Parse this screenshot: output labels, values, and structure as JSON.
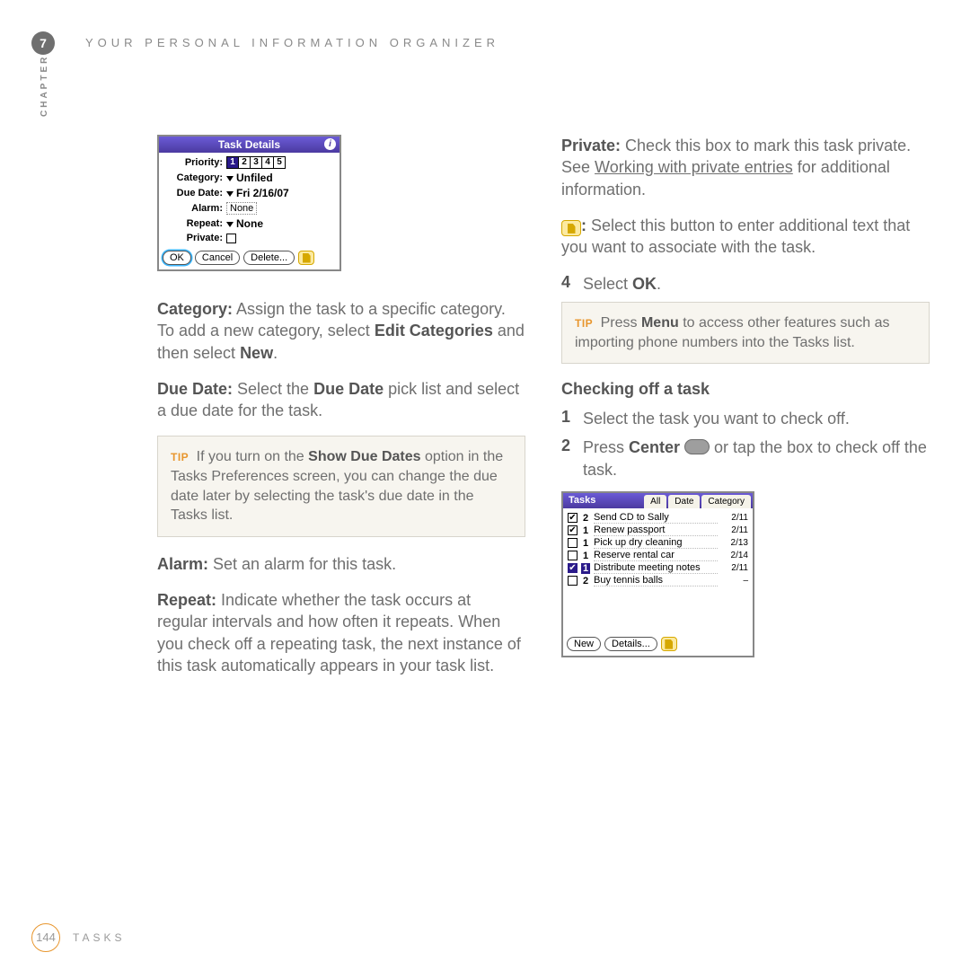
{
  "header": {
    "chapter_number": "7",
    "running_title": "YOUR PERSONAL INFORMATION ORGANIZER",
    "chapter_label": "CHAPTER"
  },
  "task_details": {
    "title": "Task Details",
    "priority_label": "Priority:",
    "priority_values": [
      "1",
      "2",
      "3",
      "4",
      "5"
    ],
    "priority_selected": "1",
    "category_label": "Category:",
    "category_value": "Unfiled",
    "due_date_label": "Due Date:",
    "due_date_value": "Fri 2/16/07",
    "alarm_label": "Alarm:",
    "alarm_value": "None",
    "repeat_label": "Repeat:",
    "repeat_value": "None",
    "private_label": "Private:",
    "buttons": {
      "ok": "OK",
      "cancel": "Cancel",
      "delete": "Delete..."
    }
  },
  "left": {
    "p_category_label": "Category:",
    "p_category_text": " Assign the task to a specific category. To add a new category, select ",
    "p_category_bold2": "Edit Categories",
    "p_category_text2": " and then select ",
    "p_category_bold3": "New",
    "p_category_end": ".",
    "p_duedate_label": "Due Date:",
    "p_duedate_text": " Select the ",
    "p_duedate_bold2": "Due Date",
    "p_duedate_text2": " pick list and select a due date for the task.",
    "tip_prefix": "TIP",
    "tip_text1": "If you turn on the ",
    "tip_bold": "Show Due Dates",
    "tip_text2": " option in the Tasks Preferences screen, you can change the due date later by selecting the task's due date in the Tasks list.",
    "p_alarm_label": "Alarm:",
    "p_alarm_text": " Set an alarm for this task.",
    "p_repeat_label": "Repeat:",
    "p_repeat_text": " Indicate whether the task occurs at regular intervals and how often it repeats. When you check off a repeating task, the next instance of this task automatically appears in your task list."
  },
  "right": {
    "p_private_label": "Private:",
    "p_private_text": " Check this box to mark this task private. See ",
    "p_private_link": "Working with private entries",
    "p_private_text2": " for additional information.",
    "p_note_bold": ":",
    "p_note_text": " Select this button to enter additional text that you want to associate with the task.",
    "step4_num": "4",
    "step4_text1": "Select ",
    "step4_bold": "OK",
    "step4_end": ".",
    "tip_prefix": "TIP",
    "tip_text1": "Press ",
    "tip_bold": "Menu",
    "tip_text2": " to access other features such as importing phone numbers into the Tasks list.",
    "h3": "Checking off a task",
    "step1_num": "1",
    "step1_text": "Select the task you want to check off.",
    "step2_num": "2",
    "step2_text1": "Press ",
    "step2_bold": "Center",
    "step2_text2": " or tap the box to check off the task."
  },
  "tasks_list": {
    "title": "Tasks",
    "tabs": [
      "All",
      "Date",
      "Category"
    ],
    "rows": [
      {
        "checked": true,
        "priority": "2",
        "name": "Send CD to Sally",
        "date": "2/11",
        "hl": false
      },
      {
        "checked": true,
        "priority": "1",
        "name": "Renew passport",
        "date": "2/11",
        "hl": false
      },
      {
        "checked": false,
        "priority": "1",
        "name": "Pick up dry cleaning",
        "date": "2/13",
        "hl": false
      },
      {
        "checked": false,
        "priority": "1",
        "name": "Reserve rental car",
        "date": "2/14",
        "hl": false
      },
      {
        "checked": true,
        "priority": "1",
        "name": "Distribute meeting notes",
        "date": "2/11",
        "hl": true
      },
      {
        "checked": false,
        "priority": "2",
        "name": "Buy tennis balls",
        "date": "–",
        "hl": false
      }
    ],
    "buttons": {
      "new": "New",
      "details": "Details..."
    }
  },
  "footer": {
    "page_number": "144",
    "section_title": "TASKS"
  }
}
